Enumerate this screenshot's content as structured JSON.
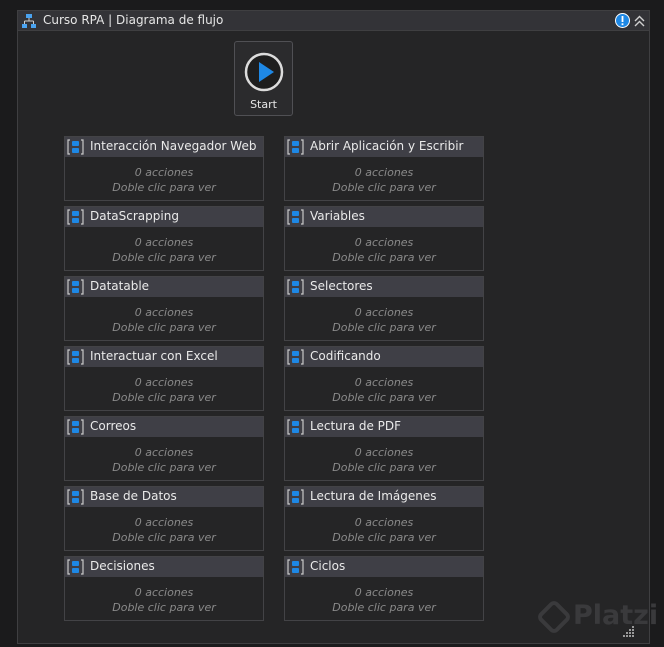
{
  "window": {
    "title": "Curso RPA | Diagrama de flujo",
    "icons": {
      "title": "flowchart-icon",
      "warning": "warning-icon",
      "collapse": "collapse-icon"
    }
  },
  "start": {
    "label": "Start",
    "icon": "play-icon"
  },
  "sequences": [
    {
      "title": "Interacción Navegador Web",
      "count": "0 acciones",
      "hint": "Doble clic para ver"
    },
    {
      "title": "Abrir Aplicación y Escribir",
      "count": "0 acciones",
      "hint": "Doble clic para ver"
    },
    {
      "title": "DataScrapping",
      "count": "0 acciones",
      "hint": "Doble clic para ver"
    },
    {
      "title": "Variables",
      "count": "0 acciones",
      "hint": "Doble clic para ver"
    },
    {
      "title": "Datatable",
      "count": "0 acciones",
      "hint": "Doble clic para ver"
    },
    {
      "title": "Selectores",
      "count": "0 acciones",
      "hint": "Doble clic para ver"
    },
    {
      "title": "Interactuar con Excel",
      "count": "0 acciones",
      "hint": "Doble clic para ver"
    },
    {
      "title": "Codificando",
      "count": "0 acciones",
      "hint": "Doble clic para ver"
    },
    {
      "title": "Correos",
      "count": "0 acciones",
      "hint": "Doble clic para ver"
    },
    {
      "title": "Lectura de PDF",
      "count": "0 acciones",
      "hint": "Doble clic para ver"
    },
    {
      "title": "Base de Datos",
      "count": "0 acciones",
      "hint": "Doble clic para ver"
    },
    {
      "title": "Lectura de Imágenes",
      "count": "0 acciones",
      "hint": "Doble clic para ver"
    },
    {
      "title": "Decisiones",
      "count": "0 acciones",
      "hint": "Doble clic para ver"
    },
    {
      "title": "Ciclos",
      "count": "0 acciones",
      "hint": "Doble clic para ver"
    }
  ],
  "watermark": "Platzi",
  "colors": {
    "accent": "#1e88e5",
    "panel": "#252526",
    "header": "#3f3f46",
    "muted": "#8a8a8a"
  }
}
